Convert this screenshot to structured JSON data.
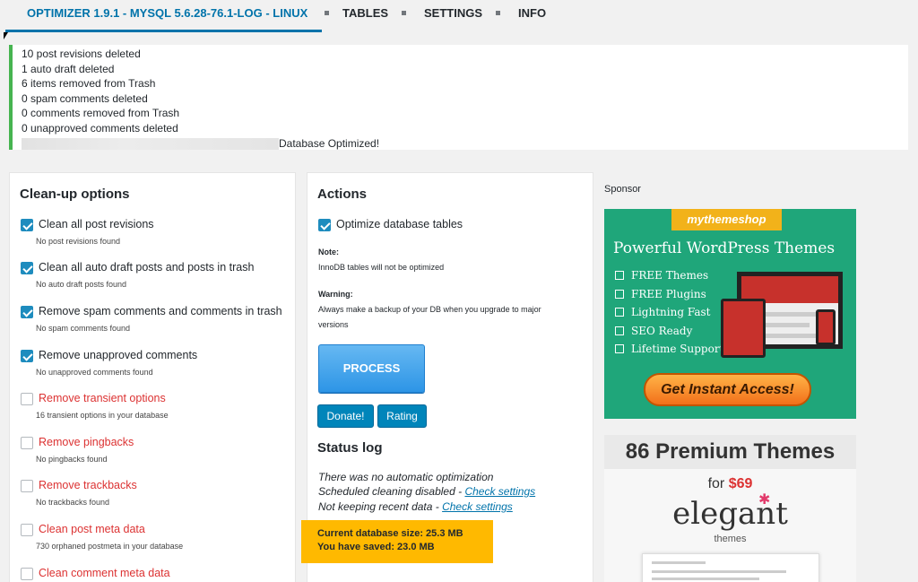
{
  "nav": {
    "active": "OPTIMIZER 1.9.1 - MYSQL 5.6.28-76.1-LOG - LINUX",
    "tables": "TABLES",
    "settings": "SETTINGS",
    "info": "INFO"
  },
  "notice": {
    "lines": [
      "10 post revisions deleted",
      "1 auto draft deleted",
      "6 items removed from Trash",
      "0 spam comments deleted",
      "0 comments removed from Trash",
      "0 unapproved comments deleted"
    ],
    "final": "Database Optimized!"
  },
  "cleanup": {
    "title": "Clean-up options",
    "options": [
      {
        "label": "Clean all post revisions",
        "sub": "No post revisions found",
        "checked": true
      },
      {
        "label": "Clean all auto draft posts and posts in trash",
        "sub": "No auto draft posts found",
        "checked": true
      },
      {
        "label": "Remove spam comments and comments in trash",
        "sub": "No spam comments found",
        "checked": true
      },
      {
        "label": "Remove unapproved comments",
        "sub": "No unapproved comments found",
        "checked": true
      },
      {
        "label": "Remove transient options",
        "sub": "16 transient options in your database",
        "checked": false
      },
      {
        "label": "Remove pingbacks",
        "sub": "No pingbacks found",
        "checked": false
      },
      {
        "label": "Remove trackbacks",
        "sub": "No trackbacks found",
        "checked": false
      },
      {
        "label": "Clean post meta data",
        "sub": "730 orphaned postmeta in your database",
        "checked": false
      },
      {
        "label": "Clean comment meta data",
        "sub": "",
        "checked": false
      }
    ]
  },
  "actions": {
    "title": "Actions",
    "optimize_label": "Optimize database tables",
    "note_label": "Note:",
    "note_text": "InnoDB tables will not be optimized",
    "warning_label": "Warning:",
    "warning_text": "Always make a backup of your DB when you upgrade to major versions",
    "process": "PROCESS",
    "donate": "Donate!",
    "rating": "Rating",
    "status_title": "Status log",
    "log1": "There was no automatic optimization",
    "log2": "Scheduled cleaning disabled - ",
    "log2_link": "Check settings",
    "log3": "Not keeping recent data - ",
    "log3_link": "Check settings",
    "db_size": "Current database size: 25.3 MB",
    "saved": "You have saved: 23.0 MB"
  },
  "sponsor": {
    "label": "Sponsor",
    "ad1": {
      "brand": "mythemeshop",
      "title": "Powerful WordPress Themes",
      "features": [
        "FREE Themes",
        "FREE Plugins",
        "Lightning Fast",
        "SEO Ready",
        "Lifetime Support"
      ],
      "cta": "Get Instant Access!"
    },
    "ad2": {
      "title": "86 Premium Themes",
      "price_prefix": "for ",
      "price": "$69",
      "logo": "elegant",
      "sub": "themes"
    }
  },
  "colors": {
    "accent": "#0073aa",
    "success": "#46b450",
    "danger": "#dc3232",
    "highlight": "#ffb900",
    "sponsor_green": "#1fa67a"
  }
}
